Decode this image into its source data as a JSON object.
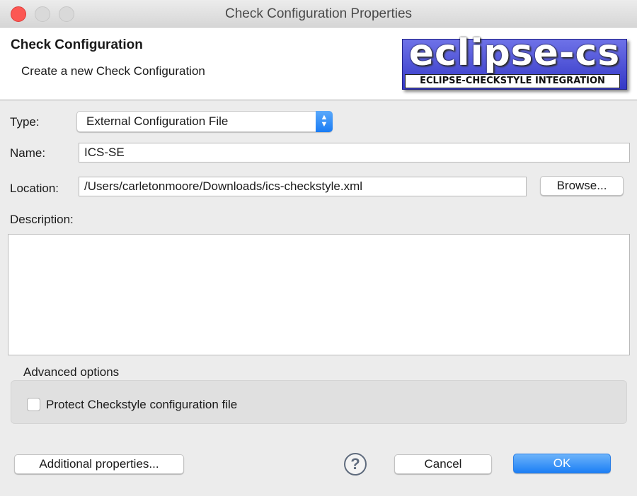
{
  "window": {
    "title": "Check Configuration Properties"
  },
  "header": {
    "title": "Check Configuration",
    "subtitle": "Create a new Check Configuration",
    "logo_text": "eclipse-cs",
    "logo_tagline": "ECLIPSE-CHECKSTYLE INTEGRATION"
  },
  "form": {
    "type_label": "Type:",
    "type_value": "External Configuration File",
    "type_arrows": "⌃⌄",
    "name_label": "Name:",
    "name_value": "ICS-SE",
    "location_label": "Location:",
    "location_value": "/Users/carletonmoore/Downloads/ics-checkstyle.xml",
    "browse_label": "Browse...",
    "description_label": "Description:",
    "description_value": ""
  },
  "advanced": {
    "title": "Advanced options",
    "protect_label": "Protect Checkstyle configuration file",
    "protect_checked": false
  },
  "footer": {
    "additional_label": "Additional properties...",
    "help_glyph": "?",
    "cancel_label": "Cancel",
    "ok_label": "OK"
  }
}
